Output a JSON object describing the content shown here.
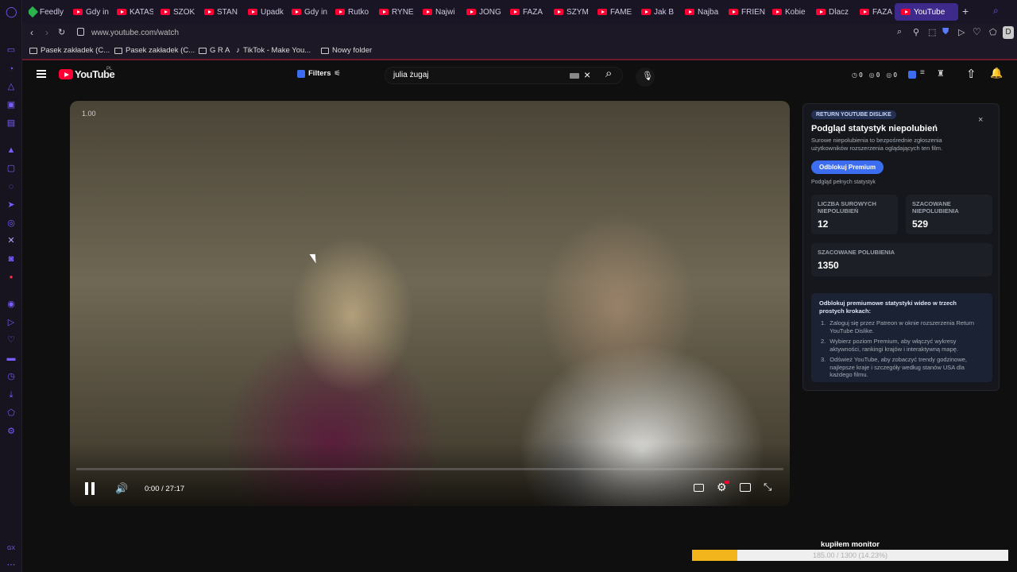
{
  "tabs": [
    {
      "label": "Feedly",
      "icon": "feedly-icon"
    },
    {
      "label": "Gdy in",
      "icon": "youtube-icon"
    },
    {
      "label": "KATAS",
      "icon": "youtube-icon"
    },
    {
      "label": "SZOK",
      "icon": "youtube-icon"
    },
    {
      "label": "STAN",
      "icon": "youtube-icon"
    },
    {
      "label": "Upadk",
      "icon": "youtube-icon"
    },
    {
      "label": "Gdy in",
      "icon": "youtube-icon"
    },
    {
      "label": "Rutko",
      "icon": "youtube-icon"
    },
    {
      "label": "RYNE",
      "icon": "youtube-icon"
    },
    {
      "label": "Najwi",
      "icon": "youtube-icon"
    },
    {
      "label": "JONG",
      "icon": "youtube-icon"
    },
    {
      "label": "FAZA",
      "icon": "youtube-icon"
    },
    {
      "label": "SZYM",
      "icon": "youtube-icon"
    },
    {
      "label": "FAME",
      "icon": "youtube-icon"
    },
    {
      "label": "Jak B",
      "icon": "youtube-icon"
    },
    {
      "label": "Najba",
      "icon": "youtube-icon"
    },
    {
      "label": "FRIEN",
      "icon": "youtube-icon"
    },
    {
      "label": "Kobie",
      "icon": "youtube-icon"
    },
    {
      "label": "Dlacz",
      "icon": "youtube-icon"
    },
    {
      "label": "FAZA",
      "icon": "youtube-icon"
    },
    {
      "label": "YouTube",
      "icon": "youtube-icon",
      "active": true
    }
  ],
  "address_bar": {
    "url": "www.youtube.com/watch"
  },
  "bookmarks": [
    {
      "label": "Pasek zakładek (C...",
      "icon": "folder-icon"
    },
    {
      "label": "Pasek zakładek (C...",
      "icon": "folder-icon"
    },
    {
      "label": "G R A",
      "icon": "folder-icon"
    },
    {
      "label": "TikTok - Make You...",
      "icon": "tiktok-icon"
    },
    {
      "label": "Nowy folder",
      "icon": "folder-icon"
    }
  ],
  "youtube": {
    "logo_text": "YouTube",
    "logo_country": "PL",
    "filters_label": "Filters",
    "search_value": "julia żugaj",
    "counters": [
      "0",
      "0",
      "0"
    ]
  },
  "player": {
    "speed_badge": "1.00",
    "time": "0:00 / 27:17",
    "progress_fraction": 0
  },
  "rtd_panel": {
    "badge": "RETURN YOUTUBE DISLIKE",
    "close": "×",
    "title": "Podgląd statystyk niepolubień",
    "subtitle": "Surowe niepolubienia to bezpośrednie zgłoszenia użytkowników rozszerzenia oglądających ten film.",
    "premium_button": "Odblokuj Premium",
    "full_stats_note": "Podgląd pełnych statystyk",
    "stats": [
      {
        "label": "LICZBA SUROWYCH NIEPOLUBIEŃ",
        "value": "12"
      },
      {
        "label": "SZACOWANE NIEPOLUBIENIA",
        "value": "529"
      },
      {
        "label": "SZACOWANE POLUBIENIA",
        "value": "1350"
      }
    ],
    "promo_title": "Odblokuj premiumowe statystyki wideo w trzech prostych krokach:",
    "promo_steps": [
      "Zaloguj się przez Patreon w oknie rozszerzenia Return YouTube Dislike.",
      "Wybierz poziom Premium, aby włączyć wykresy aktywności, rankingi krajów i interaktywną mapę.",
      "Odśwież YouTube, aby zobaczyć trendy godzinowe, najlepsze kraje i szczegóły według stanów USA dla każdego filmu."
    ]
  },
  "goal_overlay": {
    "title": "kupiłem monitor",
    "progress_text": "185.00 / 1300 (14.23%)",
    "progress_fraction": 0.1423
  },
  "colors": {
    "accent": "#7b5cff",
    "yt_red": "#ff0033",
    "premium_blue": "#3c6df0",
    "goal_fill": "#f2b51c"
  }
}
